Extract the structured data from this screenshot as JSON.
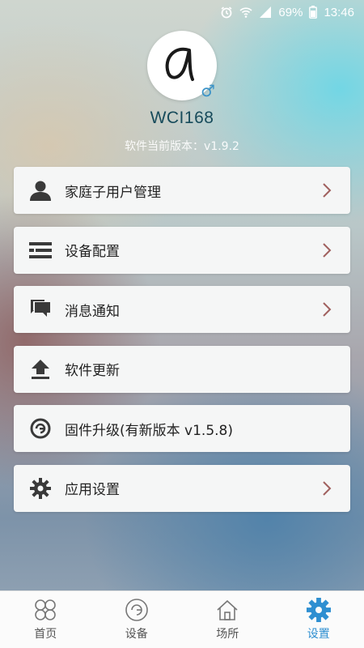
{
  "status_bar": {
    "battery": "69%",
    "time": "13:46",
    "icons": [
      "alarm-icon",
      "wifi-icon",
      "signal-icon",
      "battery-icon"
    ]
  },
  "profile": {
    "username": "WCI168",
    "software_version": "软件当前版本：v1.9.2",
    "gender_symbol": "♂"
  },
  "menu": [
    {
      "label": "家庭子用户管理",
      "icon": "user-icon",
      "has_arrow": true
    },
    {
      "label": "设备配置",
      "icon": "list-icon",
      "has_arrow": true
    },
    {
      "label": "消息通知",
      "icon": "chat-icon",
      "has_arrow": true
    },
    {
      "label": "软件更新",
      "icon": "upload-icon",
      "has_arrow": false
    },
    {
      "label": "固件升级(有新版本 v1.5.8)",
      "icon": "firmware-icon",
      "has_arrow": false
    },
    {
      "label": "应用设置",
      "icon": "gear-icon",
      "has_arrow": true
    }
  ],
  "tabs": [
    {
      "label": "首页",
      "icon": "home-grid-icon",
      "active": false
    },
    {
      "label": "设备",
      "icon": "device-icon",
      "active": false
    },
    {
      "label": "场所",
      "icon": "house-icon",
      "active": false
    },
    {
      "label": "设置",
      "icon": "settings-gear-icon",
      "active": true
    }
  ],
  "colors": {
    "accent": "#2e8fd1",
    "chevron": "#a0605e",
    "username": "#174b5b",
    "icon_dark": "#3a3a3a"
  }
}
